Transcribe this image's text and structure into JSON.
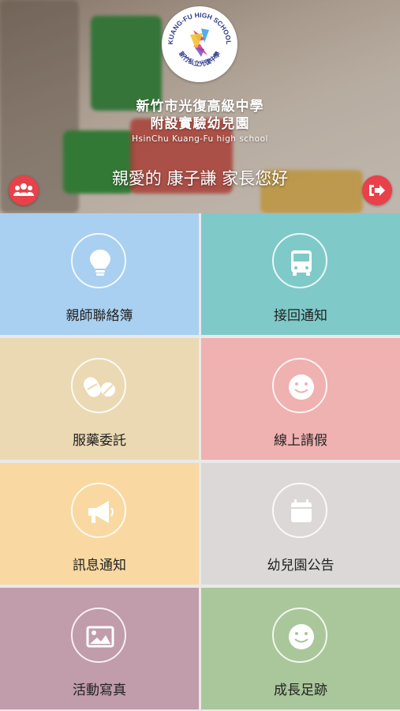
{
  "header": {
    "logo": {
      "arc_text": "KUANG-FU HIGH SCHOOL",
      "bottom_text": "新竹私立光復中學",
      "icon": "kuangfu-emblem-icon"
    },
    "school_name_line1": "新竹市光復高級中學",
    "school_name_line2": "附設實驗幼兒園",
    "school_name_en": "HsinChu  Kuang-Fu high school",
    "greeting": "親愛的 康子謙 家長您好",
    "left_button_icon": "users-icon",
    "right_button_icon": "sign-out-icon",
    "accent_color": "#e8414a"
  },
  "menu": {
    "items": [
      {
        "label": "親師聯絡簿",
        "icon": "lightbulb-icon",
        "color": "#a9d0f0"
      },
      {
        "label": "接回通知",
        "icon": "bus-icon",
        "color": "#7fc9c9"
      },
      {
        "label": "服藥委託",
        "icon": "pills-icon",
        "color": "#ead9b3"
      },
      {
        "label": "線上請假",
        "icon": "smile-icon",
        "color": "#f0b1b1"
      },
      {
        "label": "訊息通知",
        "icon": "megaphone-icon",
        "color": "#f9d9a1"
      },
      {
        "label": "幼兒園公告",
        "icon": "calendar-icon",
        "color": "#dcd8d8"
      },
      {
        "label": "活動寫真",
        "icon": "image-icon",
        "color": "#c19caa"
      },
      {
        "label": "成長足跡",
        "icon": "smile-icon",
        "color": "#a9c79b"
      }
    ]
  }
}
